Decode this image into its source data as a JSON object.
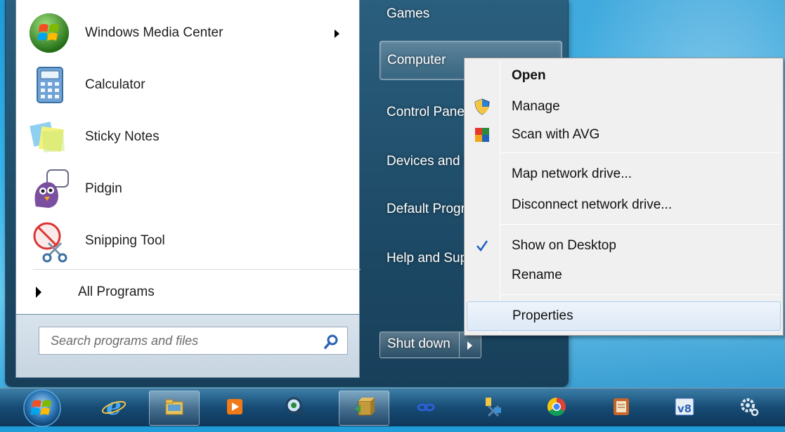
{
  "start_menu": {
    "programs": [
      {
        "label": "Windows Media Center",
        "icon": "windows-media-center-icon",
        "has_submenu": true
      },
      {
        "label": "Calculator",
        "icon": "calculator-icon"
      },
      {
        "label": "Sticky Notes",
        "icon": "sticky-notes-icon"
      },
      {
        "label": "Pidgin",
        "icon": "pidgin-icon"
      },
      {
        "label": "Snipping Tool",
        "icon": "snipping-tool-icon"
      }
    ],
    "all_programs": "All Programs",
    "search_placeholder": "Search programs and files",
    "right_items": {
      "games": "Games",
      "computer": "Computer",
      "control_panel": "Control Panel",
      "devices": "Devices and Printers",
      "default_programs": "Default Programs",
      "help": "Help and Support"
    },
    "shutdown": "Shut down"
  },
  "context_menu": {
    "items": [
      {
        "label": "Open",
        "bold": true
      },
      {
        "label": "Manage",
        "icon": "shield-icon"
      },
      {
        "label": "Scan with AVG",
        "icon": "avg-icon"
      },
      {
        "label": "Map network drive..."
      },
      {
        "label": "Disconnect network drive..."
      },
      {
        "label": "Show on Desktop",
        "checked": true
      },
      {
        "label": "Rename"
      },
      {
        "label": "Properties",
        "hovered": true
      }
    ]
  },
  "taskbar": {
    "buttons": [
      "internet-explorer-icon",
      "file-explorer-icon",
      "media-player-icon",
      "search-magnifier-icon",
      "installer-icon",
      "link-icon",
      "network-tool-icon",
      "chrome-icon",
      "notes-app-icon",
      "v8-icon",
      "settings-icon"
    ]
  },
  "colors": {
    "accent": "#1d4a66",
    "hover": "#dde9f6",
    "check": "#1f5fbf"
  }
}
